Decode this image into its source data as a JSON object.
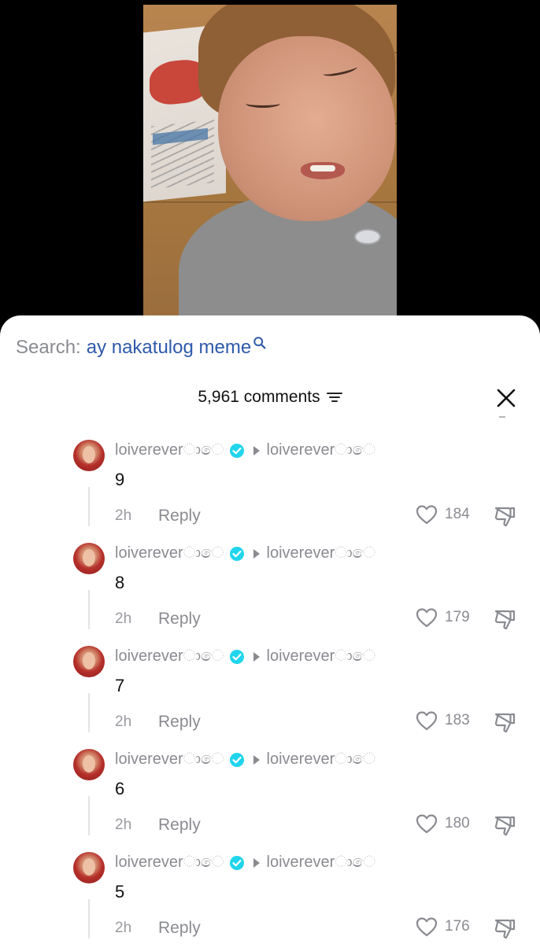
{
  "search": {
    "label": "Search:",
    "query": "ay nakatulog meme"
  },
  "header": {
    "count_label": "5,961 comments"
  },
  "icons": {
    "search": "search-icon",
    "filter": "filter-icon",
    "close": "close-icon",
    "verified": "verified-badge-icon",
    "reply_arrow": "reply-arrow-icon",
    "like": "heart-icon",
    "dislike": "thumbs-down-icon"
  },
  "colors": {
    "search_query": "#2e5aa9",
    "verified": "#20d5ec",
    "muted_text": "#8a8b91"
  },
  "comments": [
    {
      "author": "loivereverාෙ",
      "reply_to": "loivereverාෙ",
      "text": "9",
      "time": "2h",
      "reply_label": "Reply",
      "likes": "184"
    },
    {
      "author": "loivereverාෙ",
      "reply_to": "loivereverාෙ",
      "text": "8",
      "time": "2h",
      "reply_label": "Reply",
      "likes": "179"
    },
    {
      "author": "loivereverාෙ",
      "reply_to": "loivereverාෙ",
      "text": "7",
      "time": "2h",
      "reply_label": "Reply",
      "likes": "183"
    },
    {
      "author": "loivereverාෙ",
      "reply_to": "loivereverාෙ",
      "text": "6",
      "time": "2h",
      "reply_label": "Reply",
      "likes": "180"
    },
    {
      "author": "loivereverාෙ",
      "reply_to": "loivereverාෙ",
      "text": "5",
      "time": "2h",
      "reply_label": "Reply",
      "likes": "176"
    }
  ]
}
